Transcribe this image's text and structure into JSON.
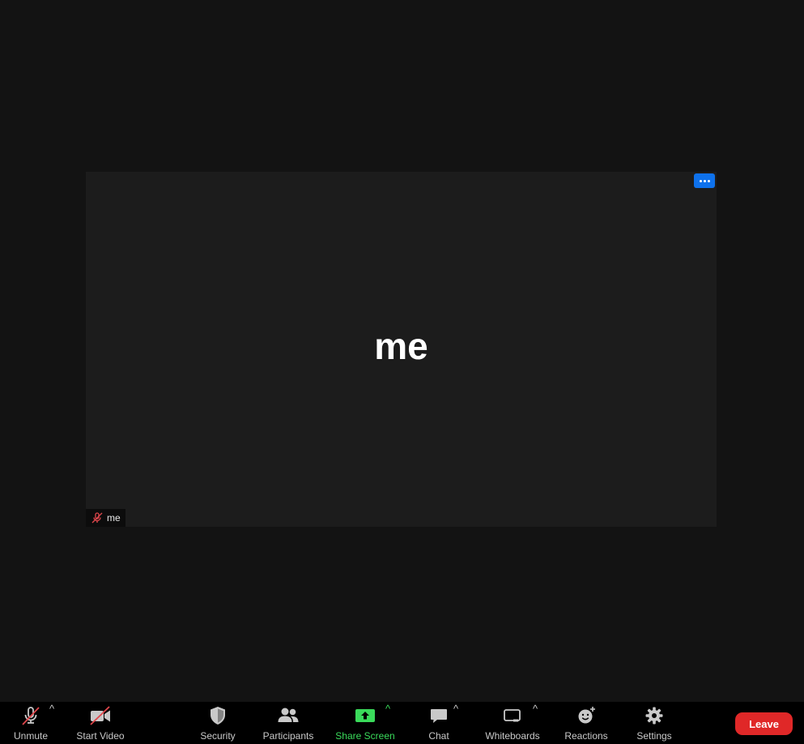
{
  "tile": {
    "display_name": "me",
    "label_name": "me"
  },
  "toolbar": {
    "unmute_label": "Unmute",
    "start_video_label": "Start Video",
    "security_label": "Security",
    "participants_label": "Participants",
    "share_screen_label": "Share Screen",
    "chat_label": "Chat",
    "whiteboards_label": "Whiteboards",
    "reactions_label": "Reactions",
    "settings_label": "Settings",
    "leave_label": "Leave",
    "caret": "^"
  },
  "colors": {
    "background": "#131313",
    "tile": "#1c1c1c",
    "accent_blue": "#0e71eb",
    "share_green": "#3adb5b",
    "leave_red": "#e02828",
    "muted_red": "#e0474c"
  },
  "icons": {
    "unmute": "muted-microphone-icon",
    "start_video": "video-off-icon",
    "security": "shield-icon",
    "participants": "people-icon",
    "share_screen": "share-up-arrow-icon",
    "chat": "chat-bubble-icon",
    "whiteboards": "whiteboard-icon",
    "reactions": "smiley-add-icon",
    "settings": "gear-icon",
    "tile_more": "more-dots-icon"
  }
}
